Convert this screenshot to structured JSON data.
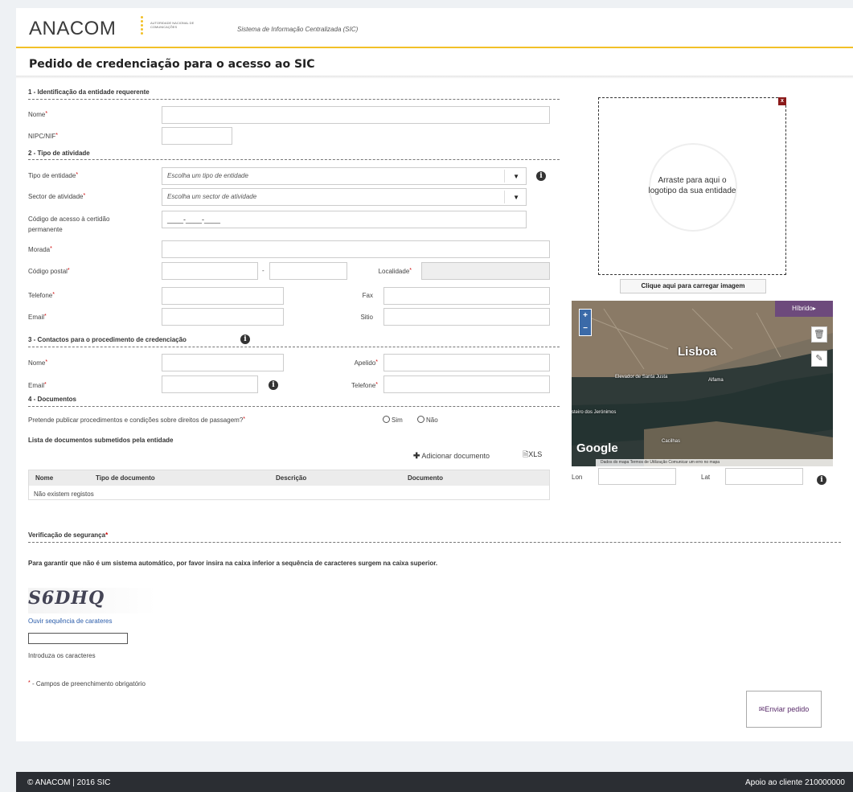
{
  "header": {
    "logo": "ANACOM",
    "logo_sub": "AUTORIDADE NACIONAL DE COMUNICAÇÕES",
    "system_title": "Sistema de Informação Centralizada (SIC)"
  },
  "page_title": "Pedido de credenciação para o acesso ao SIC",
  "sections": {
    "s1": "1 - Identificação da entidade requerente",
    "s2": "2 - Tipo de atividade",
    "s3": "3 - Contactos para o procedimento de credenciação",
    "s4": "4 - Documentos"
  },
  "labels": {
    "nome": "Nome",
    "nipc": "NIPC/NIF",
    "tipo_entidade": "Tipo de entidade",
    "sector": "Sector de atividade",
    "codigo_acesso_1": "Código de acesso à certidão",
    "codigo_acesso_2": "permanente",
    "morada": "Morada",
    "codigo_postal": "Código postal",
    "localidade": "Localidade",
    "telefone": "Telefone",
    "fax": "Fax",
    "email": "Email",
    "sitio": "Sitio",
    "c_nome": "Nome",
    "c_apelido": "Apelido",
    "c_email": "Email",
    "c_telefone": "Telefone",
    "cp_dash": "-",
    "required": "*"
  },
  "selects": {
    "tipo_entidade": "Escolha um tipo de entidade",
    "sector": "Escolha um sector de atividade"
  },
  "masked_code": "____-____-____",
  "documents": {
    "question": "Pretende publicar procedimentos e condições sobre direitos de passagem?",
    "opt_sim": "Sim",
    "opt_nao": "Não",
    "list_title": "Lista de documentos submetidos pela entidade",
    "add_label": "Adicionar documento",
    "xls_label": "XLS",
    "columns": [
      "Nome",
      "Tipo de documento",
      "Descrição",
      "Documento"
    ],
    "empty": "Não existem registos"
  },
  "dropzone": {
    "text_1": "Arraste para aqui o",
    "text_2": "logotipo da sua entidade",
    "close": "x",
    "upload_button": "Clique aqui para carregar imagem"
  },
  "map": {
    "mode": "Híbrido",
    "city": "Lisboa",
    "google": "Google",
    "place_1": "Elevador de Santa Justa",
    "place_2": "Alfama",
    "place_3": "steiro dos Jerónimos",
    "place_4": "Cacilhas",
    "footer": "Dados do mapa   Termos de Utilização   Comunicar um erro no mapa",
    "lon_label": "Lon",
    "lat_label": "Lat"
  },
  "security": {
    "title": "Verificação de segurança",
    "instruction": "Para garantir que não é um sistema automático, por favor insira na caixa inferior a sequência de caracteres surgem na caixa superior.",
    "captcha_text": "S6DHQ",
    "audio_link": "Ouvir sequência de carateres",
    "input_label": "Introduza os caracteres"
  },
  "required_note": "- Campos de preenchimento obrigatório",
  "submit_label": "Enviar pedido",
  "footer": {
    "left": "© ANACOM | 2016 SIC",
    "right": "Apoio ao cliente 210000000"
  },
  "colors": {
    "accent": "#f2c028",
    "brand_purple": "#6d4a7c",
    "required": "#cc0000",
    "footer_bg": "#2b2e33"
  }
}
